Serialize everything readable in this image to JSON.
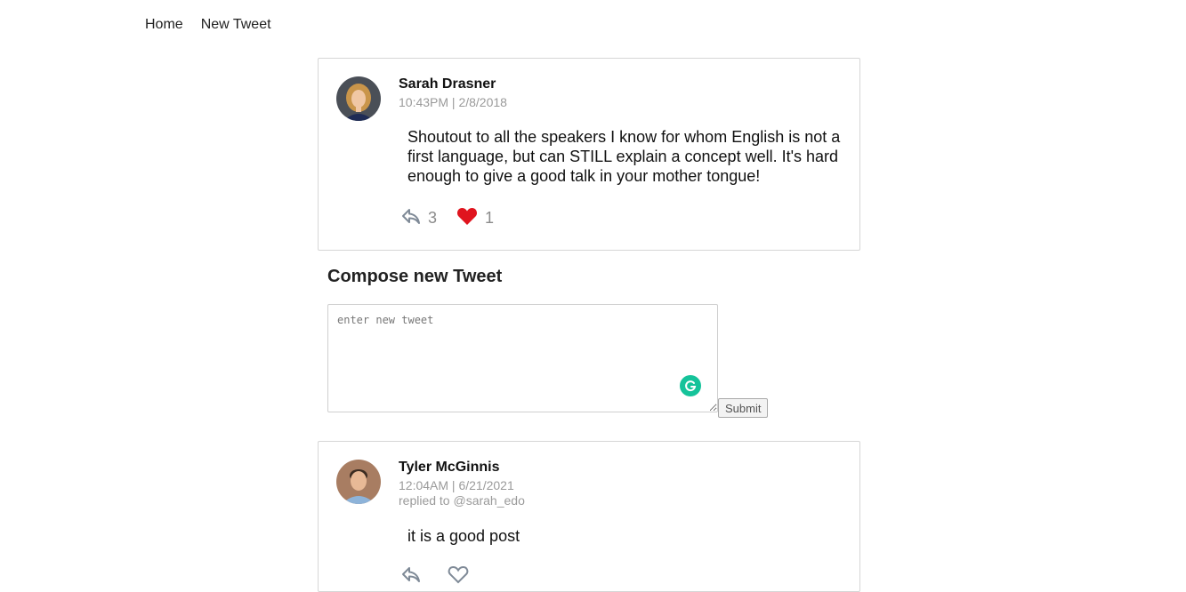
{
  "nav": {
    "home_label": "Home",
    "new_tweet_label": "New Tweet"
  },
  "tweets": [
    {
      "author": "Sarah Drasner",
      "timestamp": "10:43PM | 2/8/2018",
      "text": "Shoutout to all the speakers I know for whom English is not a first language, but can STILL explain a concept well. It's hard enough to give a good talk in your mother tongue!",
      "replies": "3",
      "likes": "1",
      "liked": true
    },
    {
      "author": "Tyler McGinnis",
      "timestamp": "12:04AM | 6/21/2021",
      "replying_to": "replied to @sarah_edo",
      "text": "it is a good post",
      "replies": "",
      "likes": "",
      "liked": false
    }
  ],
  "compose": {
    "title": "Compose new Tweet",
    "placeholder": "enter new tweet",
    "submit_label": "Submit"
  },
  "colors": {
    "like_active": "#e0141e",
    "icon_gray": "#7f8a97",
    "grammarly": "#15c39a"
  },
  "icons": {
    "reply": "reply-arrow-icon",
    "like": "heart-icon",
    "grammarly": "grammarly-icon"
  }
}
